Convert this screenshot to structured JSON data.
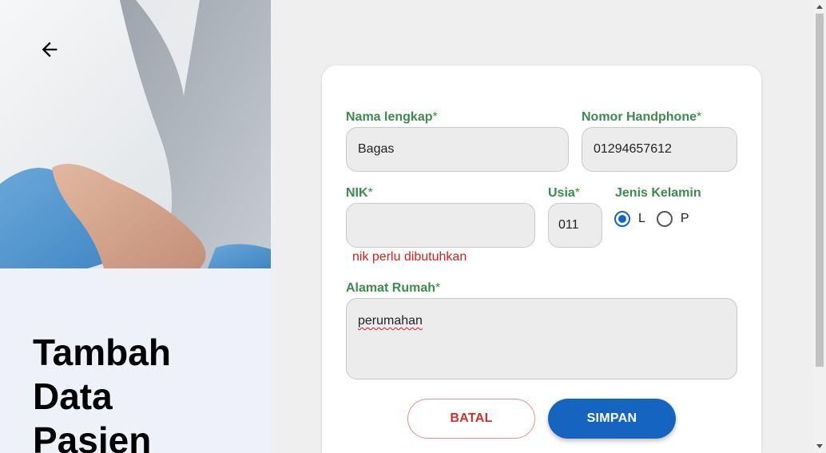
{
  "page": {
    "title_lines": [
      "Tambah",
      "Data",
      "Pasien"
    ]
  },
  "form": {
    "nama": {
      "label": "Nama lengkap",
      "required_mark": "*",
      "value": "Bagas"
    },
    "phone": {
      "label": "Nomor Handphone",
      "required_mark": "*",
      "value": "01294657612"
    },
    "nik": {
      "label": "NIK",
      "required_mark": "*",
      "value": "",
      "error": "nik perlu dibutuhkan"
    },
    "usia": {
      "label": "Usia",
      "required_mark": "*",
      "value": "011"
    },
    "gender": {
      "label": "Jenis Kelamin",
      "options": [
        {
          "label": "L",
          "checked": true
        },
        {
          "label": "P",
          "checked": false
        }
      ]
    },
    "alamat": {
      "label": "Alamat Rumah",
      "required_mark": "*",
      "value": "perumahan"
    },
    "cancel_label": "BATAL",
    "save_label": "SIMPAN"
  },
  "colors": {
    "accent": "#1565c0",
    "label_green": "#3c8a4c",
    "error_red": "#d21f1f"
  },
  "icons": {
    "back": "arrow-left-icon"
  }
}
